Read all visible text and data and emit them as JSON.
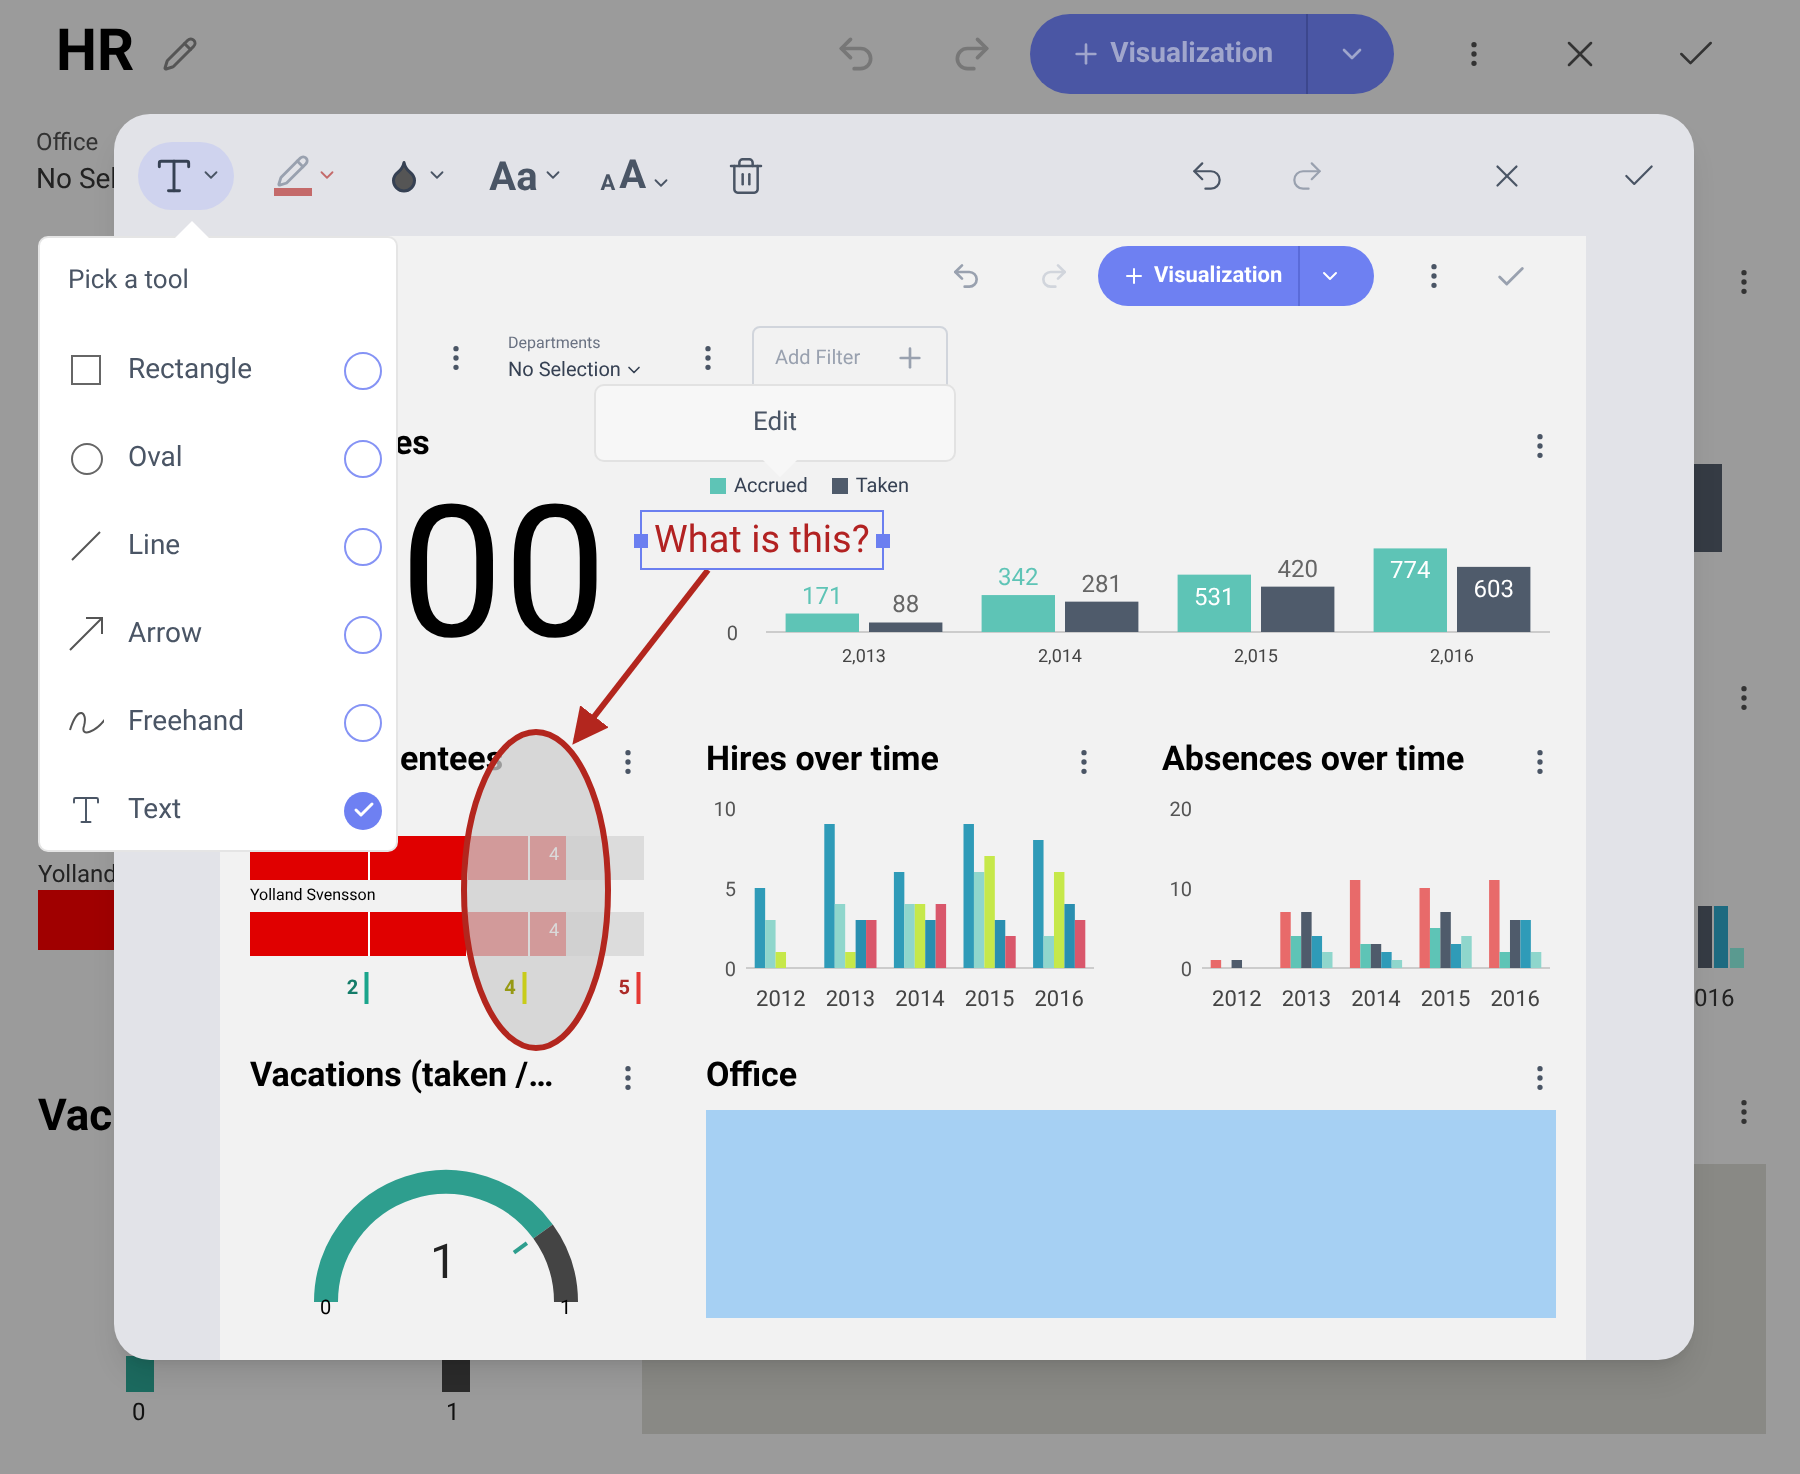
{
  "page": {
    "title": "HR",
    "add_button": "Visualization",
    "filter": {
      "label": "Office",
      "value": "No Sel"
    },
    "row_label": "Yolland",
    "section_title": "Vac",
    "axis_label": "016",
    "gauge_min": "0",
    "gauge_max": "1"
  },
  "toolbar": {
    "tools": [
      {
        "kind": "text",
        "selected": true
      },
      {
        "kind": "pen",
        "selected": false
      },
      {
        "kind": "fill",
        "selected": false
      },
      {
        "kind": "font",
        "label": "Aa",
        "selected": false
      },
      {
        "kind": "size",
        "small": "A",
        "large": "A",
        "selected": false
      },
      {
        "kind": "delete",
        "selected": false
      }
    ],
    "redo_disabled": true
  },
  "tool_menu": {
    "title": "Pick a tool",
    "items": [
      {
        "kind": "rectangle",
        "label": "Rectangle",
        "selected": false
      },
      {
        "kind": "oval",
        "label": "Oval",
        "selected": false
      },
      {
        "kind": "line",
        "label": "Line",
        "selected": false
      },
      {
        "kind": "arrow",
        "label": "Arrow",
        "selected": false
      },
      {
        "kind": "freehand",
        "label": "Freehand",
        "selected": false
      },
      {
        "kind": "text",
        "label": "Text",
        "selected": true
      }
    ]
  },
  "annotation": {
    "text": "What is this?",
    "selected": true
  },
  "context_menu": {
    "items": [
      "Edit"
    ]
  },
  "dashboard": {
    "add_button": "Visualization",
    "filter": {
      "label": "Departments",
      "value": "No Selection"
    },
    "add_filter": "Add Filter",
    "widgets": [
      {
        "kind": "kpi",
        "title": "es",
        "value": "00"
      },
      {
        "kind": "bar",
        "chart_data": {
          "type": "bar",
          "categories": [
            "2,013",
            "2,014",
            "2,015",
            "2,016"
          ],
          "series": [
            {
              "name": "Accrued",
              "color": "#5ec4b6",
              "values": [
                171,
                342,
                531,
                774
              ]
            },
            {
              "name": "Taken",
              "color": "#4f5b6b",
              "values": [
                88,
                281,
                420,
                603
              ]
            }
          ],
          "annotations": [
            {
              "text": "0"
            }
          ],
          "data_labels": true
        }
      },
      {
        "kind": "bullet",
        "title": "entees",
        "rows": [
          {
            "value": "4"
          },
          {
            "name": "Yolland Svensson",
            "value": "4"
          }
        ],
        "markers": [
          {
            "label": "2",
            "color": "#1aa58c"
          },
          {
            "label": "4",
            "color": "#c8cc1a"
          },
          {
            "label": "5",
            "color": "#e53935"
          }
        ]
      },
      {
        "kind": "bar",
        "title": "Hires over time",
        "chart_data": {
          "type": "bar",
          "categories": [
            "2012",
            "2013",
            "2014",
            "2015",
            "2016"
          ],
          "series": [
            {
              "color": "#2f9bb8",
              "values": [
                5,
                9,
                6,
                9,
                8
              ]
            },
            {
              "color": "#8fd6cc",
              "values": [
                3,
                4,
                4,
                6,
                2
              ]
            },
            {
              "color": "#c6e84a",
              "values": [
                1,
                1,
                4,
                7,
                6
              ]
            },
            {
              "color": "#2a8fb0",
              "values": [
                null,
                3,
                3,
                3,
                4
              ]
            },
            {
              "color": "#d9576b",
              "values": [
                null,
                3,
                4,
                2,
                3
              ]
            }
          ],
          "ylim": [
            0,
            10
          ],
          "yticks": [
            0,
            5,
            10
          ]
        }
      },
      {
        "kind": "bar",
        "title": "Absences over time",
        "chart_data": {
          "type": "bar",
          "categories": [
            "2012",
            "2013",
            "2014",
            "2015",
            "2016"
          ],
          "series": [
            {
              "color": "#e86a6a",
              "values": [
                1,
                7,
                11,
                10,
                11
              ]
            },
            {
              "color": "#5ec4b6",
              "values": [
                null,
                4,
                3,
                5,
                2
              ]
            },
            {
              "color": "#4f5b6b",
              "values": [
                1,
                7,
                3,
                7,
                6
              ]
            },
            {
              "color": "#2f9bb8",
              "values": [
                null,
                4,
                2,
                3,
                6
              ]
            },
            {
              "color": "#8fd6cc",
              "values": [
                null,
                2,
                1,
                4,
                2
              ]
            }
          ],
          "ylim": [
            0,
            20
          ],
          "yticks": [
            0,
            10,
            20
          ]
        }
      },
      {
        "kind": "gauge",
        "title": "Vacations (taken /…",
        "value": "1",
        "min": "0",
        "max": "1"
      },
      {
        "kind": "map",
        "title": "Office"
      }
    ]
  }
}
